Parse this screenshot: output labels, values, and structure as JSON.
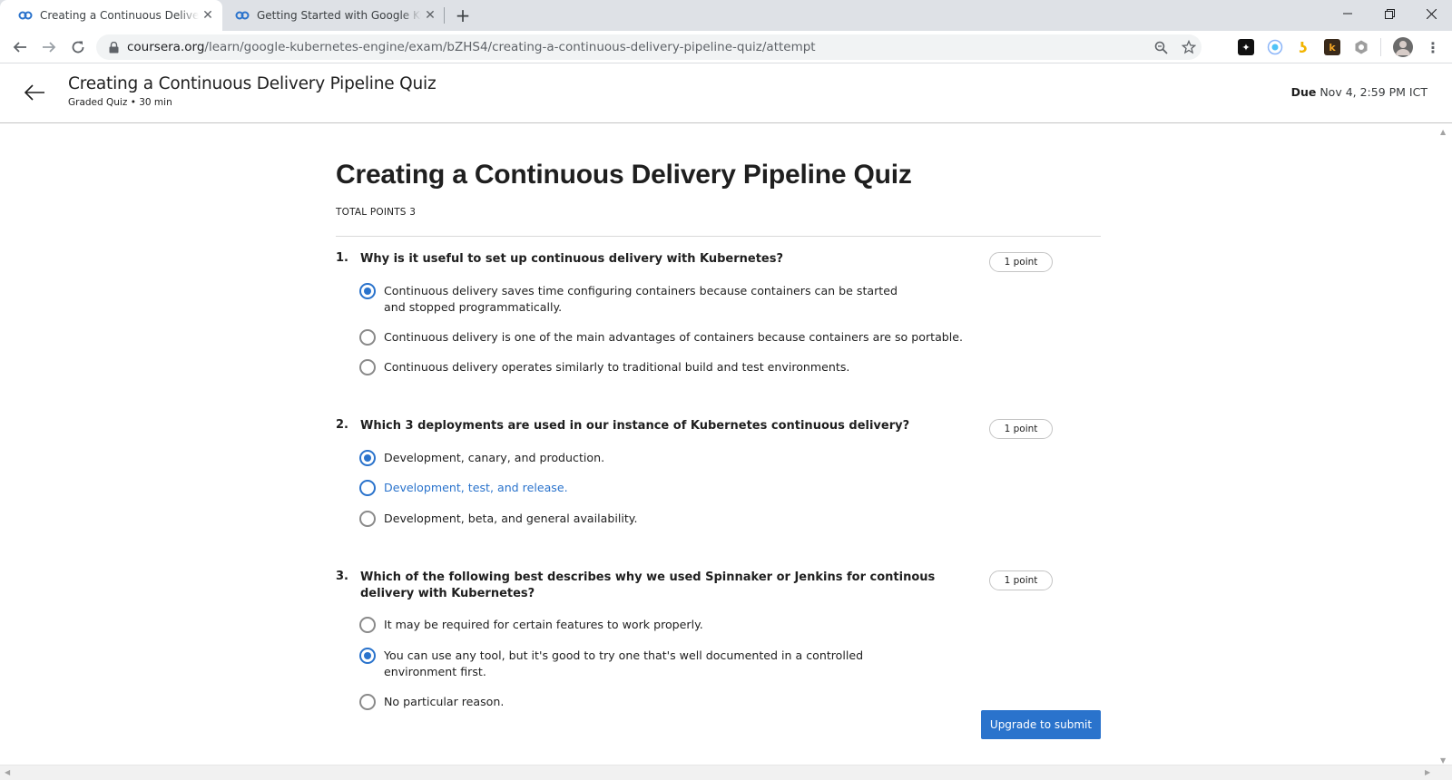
{
  "browser": {
    "tabs": [
      {
        "title": "Creating a Continuous Delivery Pipeline Quiz | Coursera",
        "active": true
      },
      {
        "title": "Getting Started with Google Kubernetes Engine | Coursera",
        "active": false
      }
    ],
    "url_host": "coursera.org",
    "url_path": "/learn/google-kubernetes-engine/exam/bZHS4/creating-a-continuous-delivery-pipeline-quiz/attempt",
    "extensions": [
      "puzzle-ext-icon",
      "circle-ext-icon",
      "bee-ext-icon",
      "k-ext-icon",
      "hex-ext-icon"
    ],
    "extension_glyphs": [
      "✦",
      "",
      "ʖ",
      "k",
      ""
    ],
    "accent": "#1a73e8"
  },
  "header": {
    "title": "Creating a Continuous Delivery Pipeline Quiz",
    "subtitle": "Graded Quiz • 30 min",
    "due_label": "Due",
    "due_value": "Nov 4, 2:59 PM ICT"
  },
  "quiz": {
    "title": "Creating a Continuous Delivery Pipeline Quiz",
    "total_points": "TOTAL POINTS 3",
    "questions": [
      {
        "number": "1.",
        "text": "Why is it useful to set up continuous delivery with Kubernetes?",
        "points": "1 point",
        "options": [
          {
            "label": "Continuous delivery saves time configuring containers because containers can be started and stopped programmatically.",
            "selected": true
          },
          {
            "label": "Continuous delivery is one of the main advantages of containers because containers are so portable.",
            "selected": false
          },
          {
            "label": "Continuous delivery operates similarly to traditional build and test environments.",
            "selected": false
          }
        ]
      },
      {
        "number": "2.",
        "text": "Which 3 deployments are used in our instance of Kubernetes continuous delivery?",
        "points": "1 point",
        "options": [
          {
            "label": "Development, canary, and production.",
            "selected": true
          },
          {
            "label": "Development, test, and release.",
            "selected": false,
            "hover": true
          },
          {
            "label": "Development, beta, and general availability.",
            "selected": false
          }
        ]
      },
      {
        "number": "3.",
        "text": "Which of the following best describes why we used Spinnaker or Jenkins for continous delivery with Kubernetes?",
        "points": "1 point",
        "options": [
          {
            "label": "It may be required for certain features to work properly.",
            "selected": false
          },
          {
            "label": "You can use any tool, but it's good to try one that's well documented in a controlled environment first.",
            "selected": true
          },
          {
            "label": "No particular reason.",
            "selected": false
          }
        ]
      }
    ],
    "submit_label": "Upgrade to submit",
    "accent": "#2a73cc"
  }
}
